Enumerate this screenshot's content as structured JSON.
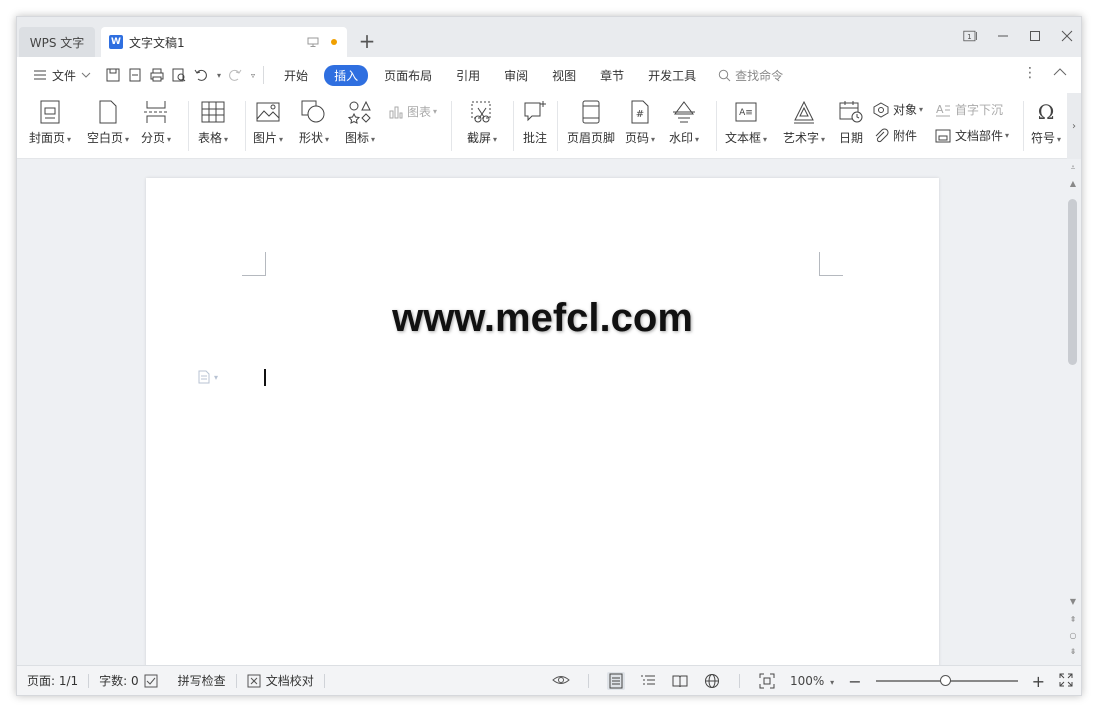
{
  "tabs": {
    "wps": "WPS 文字",
    "doc": "文字文稿1",
    "doc_logo": "W",
    "new_tab": "+"
  },
  "window_controls": {
    "page_indicator": "1"
  },
  "menubar": {
    "file": "文件",
    "tabs": [
      "开始",
      "插入",
      "页面布局",
      "引用",
      "审阅",
      "视图",
      "章节",
      "开发工具"
    ],
    "active_tab": "插入",
    "search": "查找命令"
  },
  "ribbon": {
    "cover": "封面页",
    "blank": "空白页",
    "pagebreak": "分页",
    "table": "表格",
    "picture": "图片",
    "shape": "形状",
    "icon": "图标",
    "chart": "图表",
    "screenshot": "截屏",
    "comment": "批注",
    "header_footer": "页眉页脚",
    "page_number": "页码",
    "watermark": "水印",
    "textbox": "文本框",
    "wordart": "艺术字",
    "date": "日期",
    "object": "对象",
    "dropcap": "首字下沉",
    "attachment": "附件",
    "doc_parts": "文档部件",
    "symbol": "符号"
  },
  "document": {
    "watermark_text": "www.mefcl.com"
  },
  "statusbar": {
    "page": "页面: 1/1",
    "words": "字数: 0",
    "spellcheck": "拼写检查",
    "proofread": "文档校对",
    "zoom": "100%",
    "zoom_value_percent": 100
  }
}
